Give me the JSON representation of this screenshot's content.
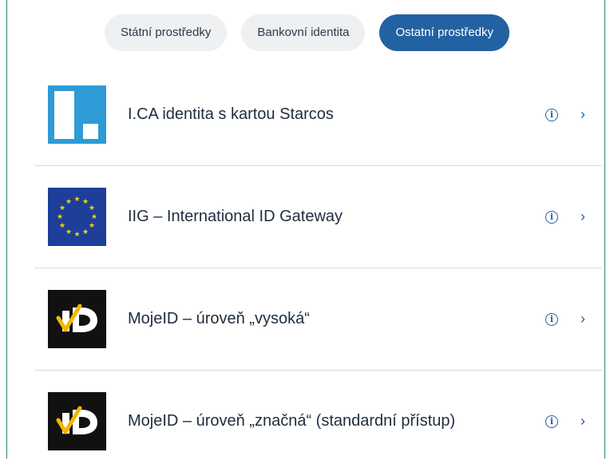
{
  "tabs": [
    {
      "label": "Státní prostředky",
      "active": false
    },
    {
      "label": "Bankovní identita",
      "active": false
    },
    {
      "label": "Ostatní prostředky",
      "active": true
    }
  ],
  "providers": [
    {
      "label": "I.CA identita s kartou Starcos",
      "logo": "ica-logo"
    },
    {
      "label": "IIG – International ID Gateway",
      "logo": "eu-flag-logo"
    },
    {
      "label": "MojeID – úroveň „vysoká“",
      "logo": "mojeid-logo"
    },
    {
      "label": "MojeID – úroveň „značná“ (standardní přístup)",
      "logo": "mojeid-logo"
    }
  ],
  "icons": {
    "info": "info-icon",
    "chevron": "chevron-right-icon"
  },
  "colors": {
    "accent": "#2362a2",
    "tab_bg": "#eff0f2",
    "divider": "#d8dcdf",
    "frame": "#1f8a70"
  }
}
